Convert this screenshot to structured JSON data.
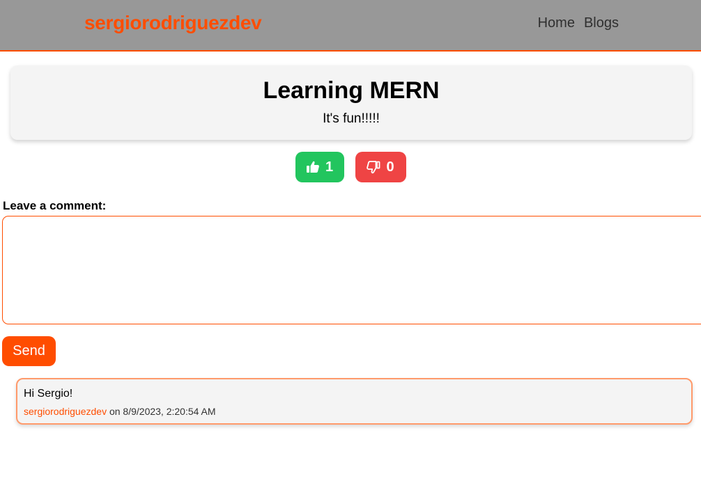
{
  "navbar": {
    "brand": "sergiorodriguezdev",
    "links": [
      "Home",
      "Blogs"
    ]
  },
  "post": {
    "title": "Learning MERN",
    "body": "It's fun!!!!!"
  },
  "votes": {
    "likes": "1",
    "dislikes": "0",
    "like_icon": "thumbs-up-icon",
    "dislike_icon": "thumbs-down-icon"
  },
  "comment_form": {
    "label": "Leave a comment:",
    "value": "",
    "send_label": "Send"
  },
  "comments": [
    {
      "text": "Hi Sergio!",
      "author": "sergiorodriguezdev",
      "date_text": "on 8/9/2023, 2:20:54 AM"
    }
  ],
  "colors": {
    "accent": "#ff4d00",
    "navbar_bg": "#989898",
    "like": "#22c55e",
    "dislike": "#ef4444",
    "card_bg": "#f4f4f4"
  }
}
